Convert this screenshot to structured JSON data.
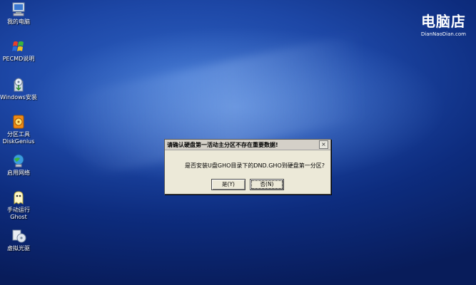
{
  "desktop": {
    "icons": [
      {
        "label": "我的电脑",
        "icon": "computer-icon"
      },
      {
        "label": "PECMD说明",
        "icon": "flag-icon"
      },
      {
        "label": "Windows安装",
        "icon": "installer-icon"
      },
      {
        "label": "分区工具\nDiskGenius",
        "icon": "disk-tool-icon"
      },
      {
        "label": "启用网络",
        "icon": "network-icon"
      },
      {
        "label": "手动运行\nGhost",
        "icon": "ghost-icon"
      },
      {
        "label": "虚拟光驱",
        "icon": "virtual-drive-icon"
      }
    ]
  },
  "logo": {
    "main": "电脑店",
    "sub": "DianNaoDian.com"
  },
  "dialog": {
    "title": "请确认硬盘第一活动主分区不存在重要数据!",
    "message": "是否安装U盘GHO目录下的DND.GHO到硬盘第一分区?",
    "yes_label": "是(Y)",
    "no_label": "否(N)",
    "close_label": "×"
  }
}
